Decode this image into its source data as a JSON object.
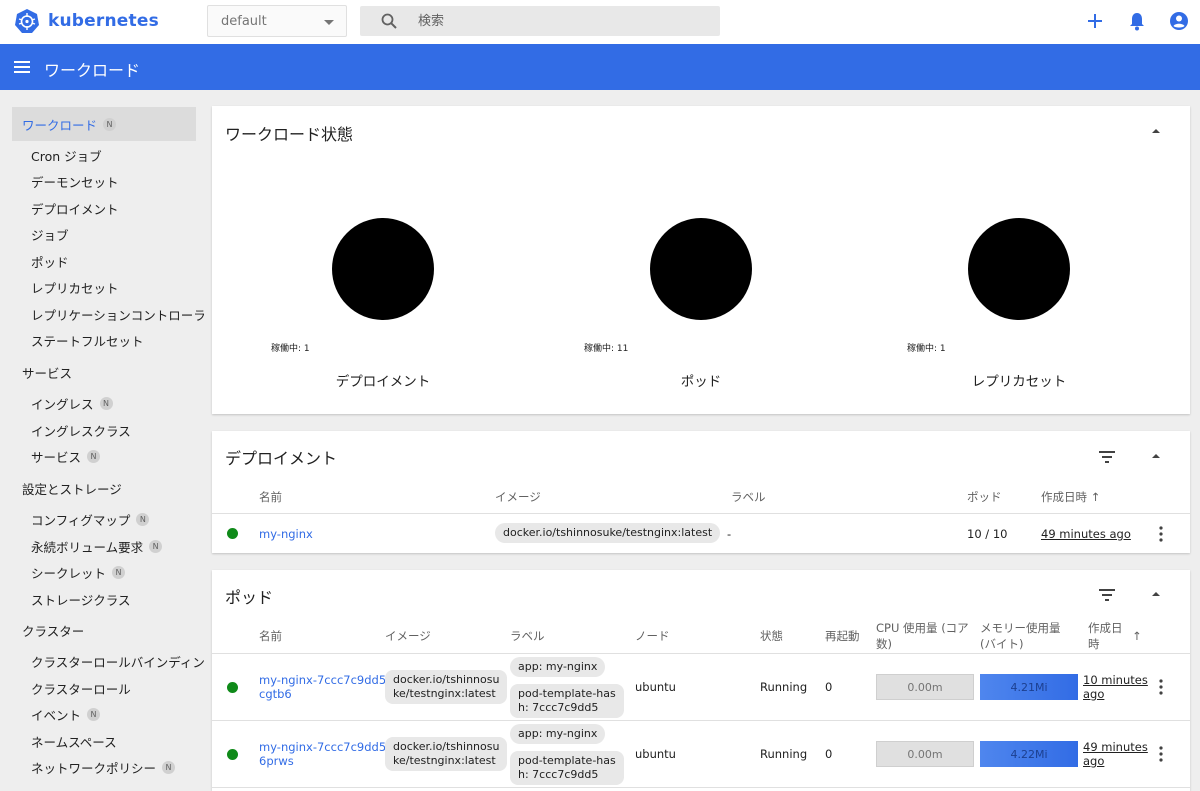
{
  "app": {
    "name": "kubernetes",
    "brand_color": "#326ce5"
  },
  "namespace": {
    "selected": "default"
  },
  "search": {
    "placeholder": "検索"
  },
  "toolbar": {
    "title": "ワークロード"
  },
  "sidebar": {
    "workloads": "ワークロード",
    "workload_items": [
      "Cron ジョブ",
      "デーモンセット",
      "デプロイメント",
      "ジョブ",
      "ポッド",
      "レプリカセット",
      "レプリケーションコントローラー",
      "ステートフルセット"
    ],
    "services": "サービス",
    "service_items": [
      "イングレス",
      "イングレスクラス",
      "サービス"
    ],
    "config": "設定とストレージ",
    "config_items": [
      "コンフィグマップ",
      "永続ボリューム要求",
      "シークレット",
      "ストレージクラス"
    ],
    "cluster": "クラスター",
    "cluster_items": [
      "クラスターロールバインディング",
      "クラスターロール",
      "イベント",
      "ネームスペース",
      "ネットワークポリシー"
    ],
    "badge": "N"
  },
  "status_card": {
    "title": "ワークロード状態",
    "charts": [
      {
        "label": "デプロイメント",
        "caption": "稼働中: 1"
      },
      {
        "label": "ポッド",
        "caption": "稼働中: 11"
      },
      {
        "label": "レプリカセット",
        "caption": "稼働中: 1"
      }
    ]
  },
  "deployments": {
    "title": "デプロイメント",
    "headers": {
      "name": "名前",
      "image": "イメージ",
      "label": "ラベル",
      "pods": "ポッド",
      "created": "作成日時"
    },
    "rows": [
      {
        "name": "my-nginx",
        "image": "docker.io/tshinnosuke/testnginx:latest",
        "label": "-",
        "pods": "10 / 10",
        "created": "49 minutes ago"
      }
    ]
  },
  "pods": {
    "title": "ポッド",
    "headers": {
      "name": "名前",
      "image": "イメージ",
      "label": "ラベル",
      "node": "ノード",
      "status": "状態",
      "restarts": "再起動",
      "cpu1": "CPU 使用量 (コア",
      "cpu2": "数)",
      "mem1": "メモリー使用量",
      "mem2": "(バイト)",
      "created1": "作成日",
      "created2": "時"
    },
    "rows": [
      {
        "name1": "my-nginx-7ccc7c9dd5-",
        "name2": "cgtb6",
        "image1": "docker.io/tshinnosu",
        "image2": "ke/testnginx:latest",
        "label1": "app: my-nginx",
        "label2a": "pod-template-has",
        "label2b": "h: 7ccc7c9dd5",
        "node": "ubuntu",
        "status": "Running",
        "restarts": "0",
        "cpu": "0.00m",
        "mem": "4.21Mi",
        "created1": "10 minutes",
        "created2": "ago"
      },
      {
        "name1": "my-nginx-7ccc7c9dd5-",
        "name2": "6prws",
        "image1": "docker.io/tshinnosu",
        "image2": "ke/testnginx:latest",
        "label1": "app: my-nginx",
        "label2a": "pod-template-has",
        "label2b": "h: 7ccc7c9dd5",
        "node": "ubuntu",
        "status": "Running",
        "restarts": "0",
        "cpu": "0.00m",
        "mem": "4.22Mi",
        "created1": "49 minutes",
        "created2": "ago"
      }
    ]
  }
}
